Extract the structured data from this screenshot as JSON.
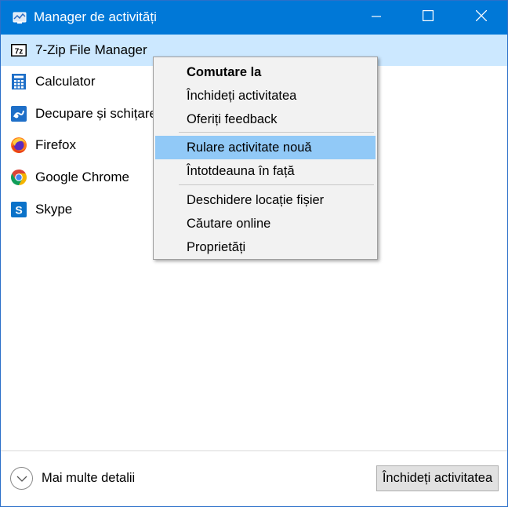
{
  "window": {
    "title": "Manager de activități"
  },
  "titlebar_buttons": {
    "minimize_icon": "minimize-icon",
    "maximize_icon": "maximize-icon",
    "close_icon": "close-icon"
  },
  "processes": [
    {
      "name": "7-Zip File Manager",
      "icon": "7zip-icon",
      "selected": true
    },
    {
      "name": "Calculator",
      "icon": "calculator-icon",
      "selected": false
    },
    {
      "name": "Decupare și schițare",
      "icon": "snip-sketch-icon",
      "selected": false
    },
    {
      "name": "Firefox",
      "icon": "firefox-icon",
      "selected": false
    },
    {
      "name": "Google Chrome",
      "icon": "chrome-icon",
      "selected": false
    },
    {
      "name": "Skype",
      "icon": "skype-icon",
      "selected": false
    }
  ],
  "context_menu": {
    "items": [
      {
        "label": "Comutare la",
        "bold": true
      },
      {
        "label": "Închideți activitatea"
      },
      {
        "label": "Oferiți feedback"
      },
      {
        "label": "Rulare activitate nouă",
        "highlighted": true
      },
      {
        "label": "Întotdeauna în față"
      },
      {
        "label": "Deschidere locație fișier"
      },
      {
        "label": "Căutare online"
      },
      {
        "label": "Proprietăți"
      }
    ]
  },
  "footer": {
    "details_label": "Mai multe detalii",
    "end_task_label": "Închideți activitatea"
  },
  "colors": {
    "titlebar": "#0078d7",
    "selected_row": "#cce8ff",
    "menu_highlight": "#91c9f7",
    "menu_background": "#f2f2f2"
  }
}
